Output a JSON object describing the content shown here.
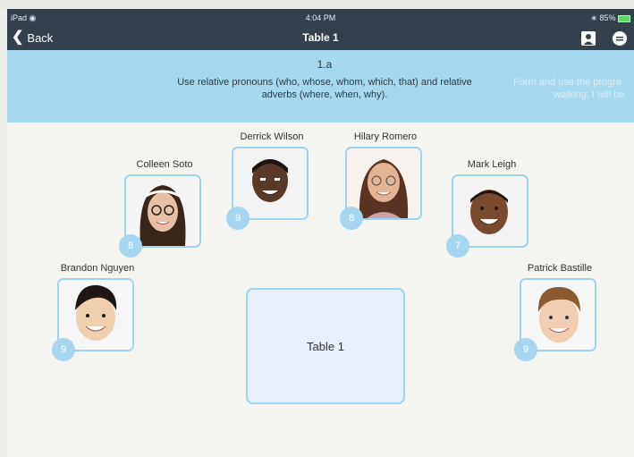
{
  "status_bar": {
    "carrier": "iPad",
    "time": "4:04 PM",
    "battery": "85%"
  },
  "nav": {
    "back_label": "Back",
    "title": "Table 1"
  },
  "banner": {
    "code": "1.a",
    "text": "Use relative pronouns (who, whose, whom, which, that) and relative adverbs (where, when, why).",
    "next_text_line1": "Form and use the progre",
    "next_text_line2": "walking; I will be"
  },
  "students": [
    {
      "name": "Derrick Wilson",
      "score": "9"
    },
    {
      "name": "Hilary Romero",
      "score": "8"
    },
    {
      "name": "Colleen Soto",
      "score": "8"
    },
    {
      "name": "Mark Leigh",
      "score": "7"
    },
    {
      "name": "Brandon Nguyen",
      "score": "9"
    },
    {
      "name": "Patrick Bastille",
      "score": "9"
    }
  ],
  "table_label": "Table 1",
  "colors": {
    "nav_bg": "#34414d",
    "banner_bg": "#a6d8ef",
    "accent": "#9fd2ee",
    "badge": "#a7d6f0"
  }
}
